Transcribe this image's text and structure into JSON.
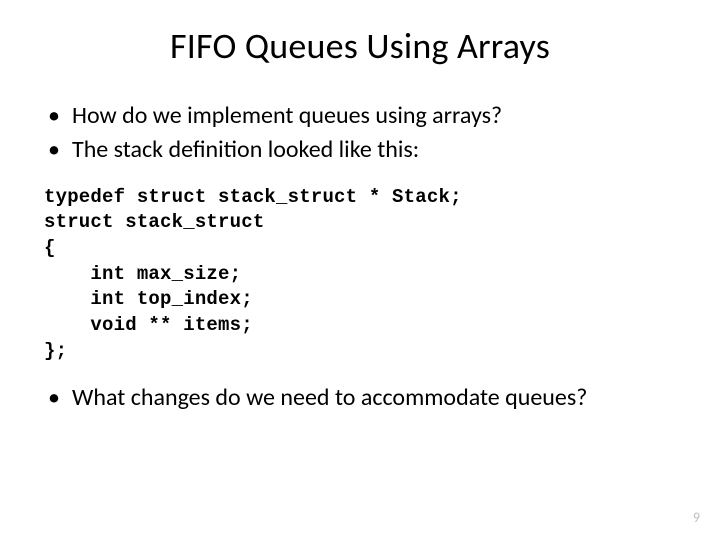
{
  "title": "FIFO Queues Using Arrays",
  "bullets": {
    "b1": "How do we implement queues using arrays?",
    "b2": "The stack definition looked like this:",
    "b3": "What changes do we need to accommodate queues?"
  },
  "code": "typedef struct stack_struct * Stack;\nstruct stack_struct\n{\n    int max_size;\n    int top_index;\n    void ** items;\n};",
  "page_number": "9"
}
